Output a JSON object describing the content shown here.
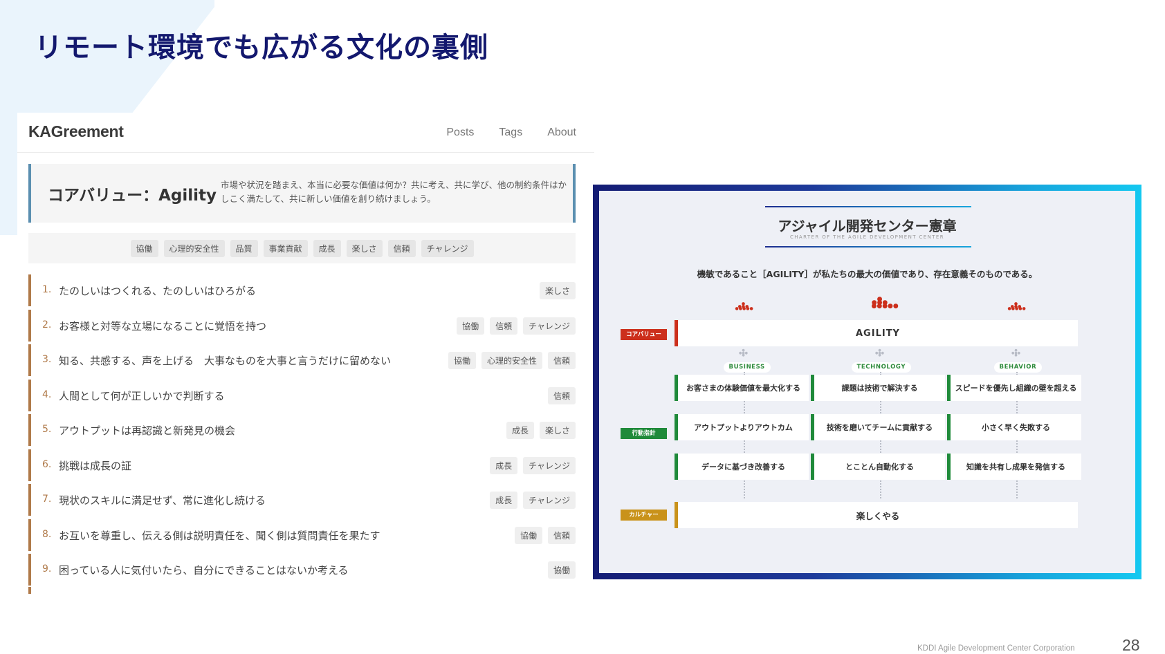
{
  "slide": {
    "title": "リモート環境でも広がる文化の裏側",
    "footer": "KDDI Agile Development Center Corporation",
    "page_number": "28"
  },
  "site": {
    "brand": "KAGreement",
    "nav": [
      "Posts",
      "Tags",
      "About"
    ],
    "hero": {
      "title": "コアバリュー：Agility",
      "description": "市場や状況を踏まえ、本当に必要な価値は何か？共に考え、共に学び、他の制約条件はかしこく満たして、共に新しい価値を創り続けましょう。"
    },
    "tags": [
      "協働",
      "心理的安全性",
      "品質",
      "事業貢献",
      "成長",
      "楽しさ",
      "信頼",
      "チャレンジ"
    ],
    "values": [
      {
        "num": "1.",
        "text": "たのしいはつくれる、たのしいはひろがる",
        "tags": [
          "楽しさ"
        ]
      },
      {
        "num": "2.",
        "text": "お客様と対等な立場になることに覚悟を持つ",
        "tags": [
          "協働",
          "信頼",
          "チャレンジ"
        ]
      },
      {
        "num": "3.",
        "text": "知る、共感する、声を上げる　大事なものを大事と言うだけに留めない",
        "tags": [
          "協働",
          "心理的安全性",
          "信頼"
        ]
      },
      {
        "num": "4.",
        "text": "人間として何が正しいかで判断する",
        "tags": [
          "信頼"
        ]
      },
      {
        "num": "5.",
        "text": "アウトプットは再認識と新発見の機会",
        "tags": [
          "成長",
          "楽しさ"
        ]
      },
      {
        "num": "6.",
        "text": "挑戦は成長の証",
        "tags": [
          "成長",
          "チャレンジ"
        ]
      },
      {
        "num": "7.",
        "text": "現状のスキルに満足せず、常に進化し続ける",
        "tags": [
          "成長",
          "チャレンジ"
        ]
      },
      {
        "num": "8.",
        "text": "お互いを尊重し、伝える側は説明責任を、聞く側は質問責任を果たす",
        "tags": [
          "協働",
          "信頼"
        ]
      },
      {
        "num": "9.",
        "text": "困っている人に気付いたら、自分にできることはないか考える",
        "tags": [
          "協働"
        ]
      }
    ]
  },
  "charter": {
    "title": "アジャイル開発センター憲章",
    "subtitle": "CHARTER OF THE AGILE DEVELOPMENT CENTER",
    "mission": "機敏であること［AGILITY］が私たちの最大の価値であり、存在意義そのものである。",
    "core_label": "コアバリュー",
    "core_value": "AGILITY",
    "action_label": "行動指針",
    "culture_label": "カルチャー",
    "culture_value": "楽しくやる",
    "columns": [
      {
        "name": "BUSINESS",
        "items": [
          "お客さまの体験価値を最大化する",
          "アウトプットよりアウトカム",
          "データに基づき改善する"
        ]
      },
      {
        "name": "TECHNOLOGY",
        "items": [
          "課題は技術で解決する",
          "技術を磨いてチームに貢献する",
          "とことん自動化する"
        ]
      },
      {
        "name": "BEHAVIOR",
        "items": [
          "スピードを優先し組織の壁を超える",
          "小さく早く失敗する",
          "知識を共有し成果を発信する"
        ]
      }
    ],
    "colors": {
      "core": "#cc2f1c",
      "action": "#1f8a3a",
      "culture": "#c9921a",
      "accent": "#13186e"
    }
  }
}
